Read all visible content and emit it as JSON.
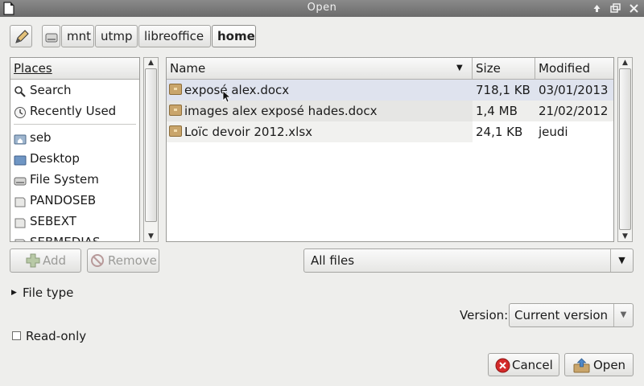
{
  "window": {
    "title": "Open"
  },
  "path_bar": {
    "crumbs": [
      {
        "label": "mnt",
        "active": false
      },
      {
        "label": "utmp",
        "active": false
      },
      {
        "label": "libreoffice",
        "active": false
      },
      {
        "label": "home",
        "active": true
      }
    ]
  },
  "places": {
    "header": "Places",
    "items": [
      {
        "label": "Search",
        "icon": "search-icon"
      },
      {
        "label": "Recently Used",
        "icon": "clock-icon"
      },
      {
        "label": "seb",
        "icon": "home-folder-icon"
      },
      {
        "label": "Desktop",
        "icon": "desktop-folder-icon"
      },
      {
        "label": "File System",
        "icon": "harddisk-icon"
      },
      {
        "label": "PANDOSEB",
        "icon": "drive-icon"
      },
      {
        "label": "SEBEXT",
        "icon": "drive-icon"
      },
      {
        "label": "SEBMEDIAS",
        "icon": "drive-icon"
      }
    ]
  },
  "file_list": {
    "columns": {
      "name": "Name",
      "size": "Size",
      "modified": "Modified"
    },
    "rows": [
      {
        "name": "exposé alex.docx",
        "size": "718,1 KB",
        "modified": "03/01/2013"
      },
      {
        "name": "images alex exposé hades.docx",
        "size": "1,4 MB",
        "modified": "21/02/2012"
      },
      {
        "name": "Loïc devoir 2012.xlsx",
        "size": "24,1 KB",
        "modified": "jeudi"
      }
    ]
  },
  "buttons": {
    "add": "Add",
    "remove": "Remove",
    "cancel": "Cancel",
    "open": "Open"
  },
  "filter": {
    "selected": "All files"
  },
  "file_type": {
    "label": "File type"
  },
  "version": {
    "label": "Version:",
    "selected": "Current version"
  },
  "read_only": {
    "label": "Read-only",
    "checked": false
  },
  "colors": {
    "titlebar": "#7a7a7a",
    "selected_row": "#dfe3ee",
    "alt_row": "#eeeeec",
    "cancel_red": "#d42a2a"
  }
}
